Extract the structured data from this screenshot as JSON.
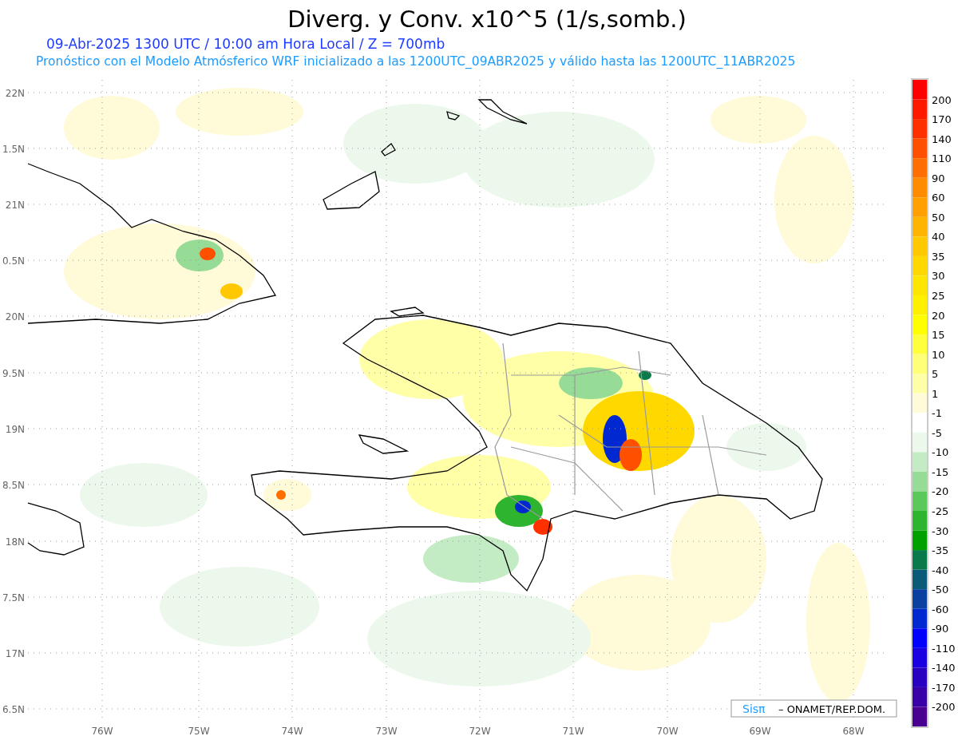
{
  "title": "Diverg. y Conv. x10^5 (1/s,somb.)",
  "subtitles": [
    "09-Abr-2025  1300 UTC / 10:00 am Hora Local / Z = 700mb",
    "Pronóstico con el Modelo Atmósferico WRF inicializado a las 1200UTC_09ABR2025 y válido hasta las  1200UTC_11ABR2025"
  ],
  "map": {
    "lat_labels": [
      "22N",
      "1.5N",
      "21N",
      "0.5N",
      "20N",
      "9.5N",
      "19N",
      "8.5N",
      "18N",
      "7.5N",
      "17N",
      "6.5N"
    ],
    "lon_labels": [
      "76W",
      "75W",
      "74W",
      "73W",
      "72W",
      "71W",
      "70W",
      "69W",
      "68W"
    ]
  },
  "colorbar": {
    "swatches": [
      {
        "color": "#ff0000"
      },
      {
        "color": "#ff1800"
      },
      {
        "color": "#ff3000"
      },
      {
        "color": "#ff5000"
      },
      {
        "color": "#ff6e00"
      },
      {
        "color": "#ff8c00"
      },
      {
        "color": "#ffa000"
      },
      {
        "color": "#ffb400"
      },
      {
        "color": "#ffc800"
      },
      {
        "color": "#ffd800"
      },
      {
        "color": "#ffe600"
      },
      {
        "color": "#fff000"
      },
      {
        "color": "#ffff00"
      },
      {
        "color": "#ffff3c"
      },
      {
        "color": "#ffff78"
      },
      {
        "color": "#ffffa8"
      },
      {
        "color": "#fffad8"
      },
      {
        "color": "#ffffff"
      },
      {
        "color": "#ecf8ec"
      },
      {
        "color": "#c4ecc4"
      },
      {
        "color": "#96dc96"
      },
      {
        "color": "#5ac85a"
      },
      {
        "color": "#2eb42e"
      },
      {
        "color": "#00a000"
      },
      {
        "color": "#0a7a4a"
      },
      {
        "color": "#0a5a78"
      },
      {
        "color": "#0a40a0"
      },
      {
        "color": "#0028d0"
      },
      {
        "color": "#0000ff"
      },
      {
        "color": "#1a00e0"
      },
      {
        "color": "#2a00c0"
      },
      {
        "color": "#3a00a8"
      },
      {
        "color": "#4a0090"
      }
    ],
    "labels": [
      "200",
      "170",
      "140",
      "110",
      "90",
      "60",
      "50",
      "40",
      "35",
      "30",
      "25",
      "20",
      "15",
      "10",
      "5",
      "1",
      "-1",
      "-5",
      "-10",
      "-15",
      "-20",
      "-25",
      "-30",
      "-35",
      "-40",
      "-50",
      "-60",
      "-90",
      "-110",
      "-140",
      "-170",
      "-200"
    ]
  },
  "credit": {
    "logo": "Sisπ",
    "text": "– ONAMET/REP.DOM."
  }
}
